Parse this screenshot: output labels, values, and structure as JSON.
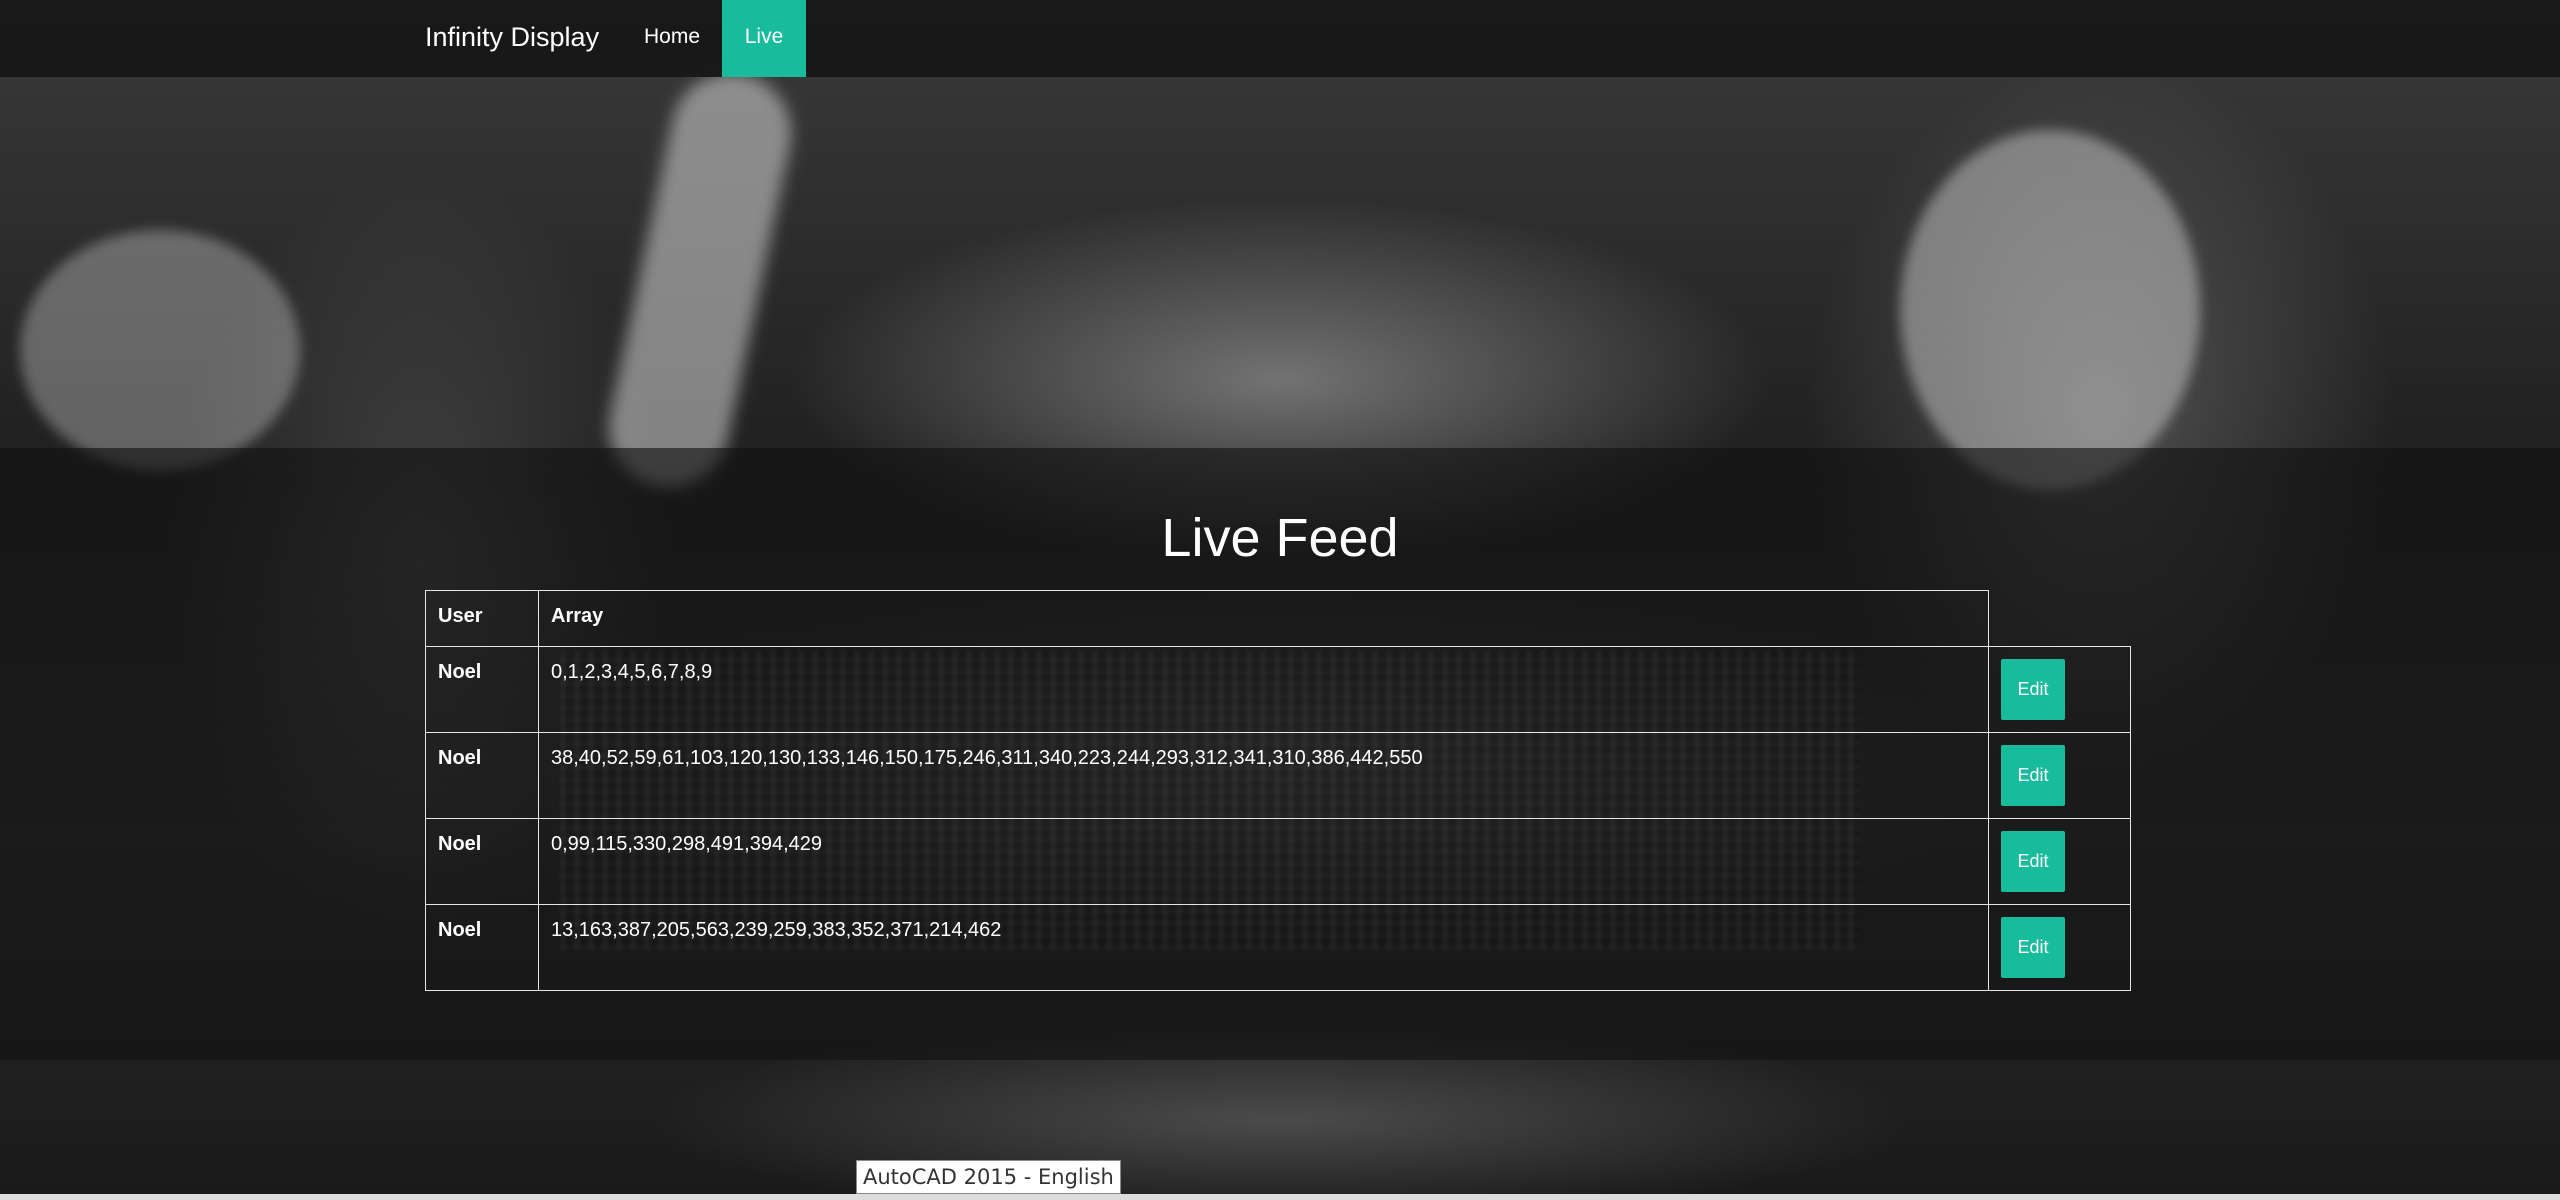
{
  "navbar": {
    "brand": "Infinity Display",
    "links": [
      {
        "label": "Home",
        "active": false
      },
      {
        "label": "Live",
        "active": true
      }
    ],
    "accent_color": "#18bc9c"
  },
  "main": {
    "title": "Live Feed",
    "table": {
      "headers": [
        "User",
        "Array",
        ""
      ],
      "rows": [
        {
          "user": "Noel",
          "array": "0,1,2,3,4,5,6,7,8,9",
          "action": "Edit"
        },
        {
          "user": "Noel",
          "array": "38,40,52,59,61,103,120,130,133,146,150,175,246,311,340,223,244,293,312,341,310,386,442,550",
          "action": "Edit"
        },
        {
          "user": "Noel",
          "array": "0,99,115,330,298,491,394,429",
          "action": "Edit"
        },
        {
          "user": "Noel",
          "array": "13,163,387,205,563,239,259,383,352,371,214,462",
          "action": "Edit"
        }
      ]
    }
  },
  "tooltip": {
    "text": "AutoCAD 2015 - English"
  }
}
